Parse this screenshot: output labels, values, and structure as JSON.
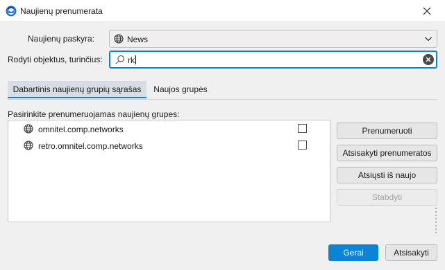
{
  "window": {
    "title": "Naujienų prenumerata"
  },
  "account": {
    "label": "Naujienų paskyra:",
    "value": "News"
  },
  "filter": {
    "label": "Rodyti objektus, turinčius:",
    "value": "rk"
  },
  "tabs": [
    {
      "label": "Dabartinis naujienų grupių sąrašas",
      "active": true
    },
    {
      "label": "Naujos grupės",
      "active": false
    }
  ],
  "list": {
    "heading": "Pasirinkite prenumeruojamas naujienų grupes:",
    "items": [
      {
        "name": "omnitel.comp.networks",
        "subscribed": false
      },
      {
        "name": "retro.omnitel.comp.networks",
        "subscribed": false
      }
    ]
  },
  "actions": {
    "subscribe": "Prenumeruoti",
    "unsubscribe": "Atsisakyti prenumeratos",
    "refresh": "Atsiųsti iš naujo",
    "stop": "Stabdyti"
  },
  "footer": {
    "ok": "Gerai",
    "cancel": "Atsisakyti"
  },
  "colors": {
    "accent": "#0a84d6",
    "tab_active_bg": "#d8dde4",
    "window_bg": "#f0f0f0"
  },
  "icons": [
    "thunderbird-icon",
    "close-icon",
    "globe-icon",
    "chevron-down-icon",
    "search-icon",
    "clear-icon"
  ]
}
